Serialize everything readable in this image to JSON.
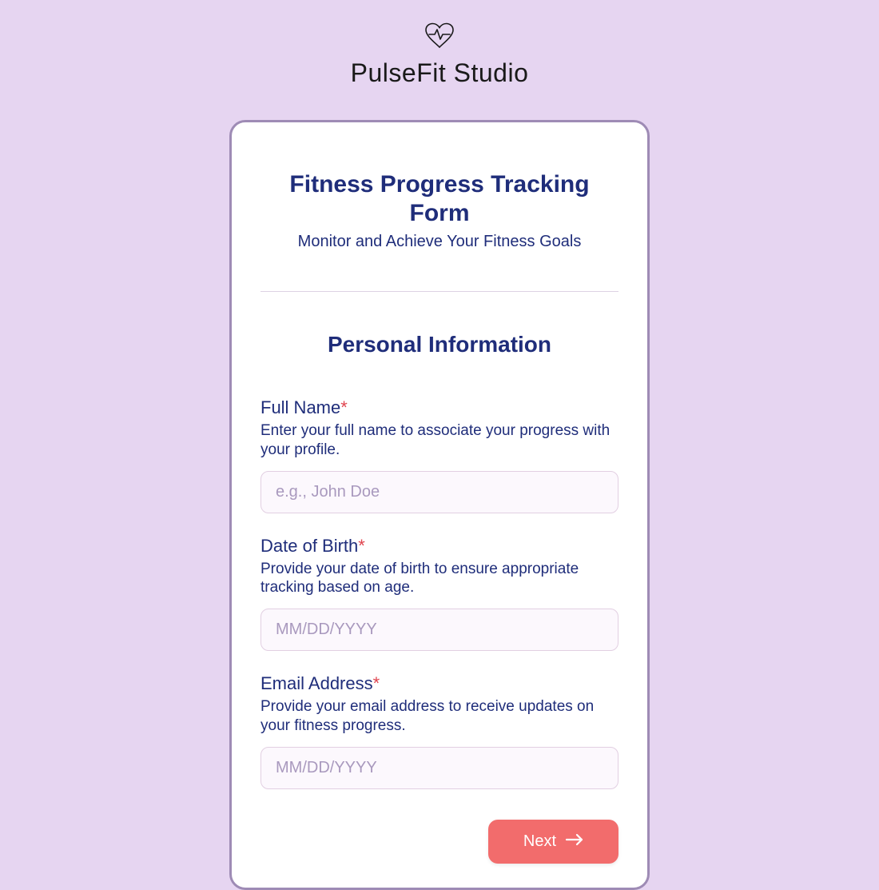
{
  "brand": {
    "name": "PulseFit Studio"
  },
  "form": {
    "title": "Fitness Progress Tracking Form",
    "subtitle": "Monitor and Achieve Your Fitness Goals",
    "section_title": "Personal Information",
    "fields": {
      "full_name": {
        "label": "Full Name",
        "required_mark": "*",
        "help": "Enter your full name to associate your progress with your profile.",
        "placeholder": "e.g., John Doe",
        "value": ""
      },
      "dob": {
        "label": "Date of Birth",
        "required_mark": "*",
        "help": "Provide your date of birth to ensure appropriate tracking based on age.",
        "placeholder": "MM/DD/YYYY",
        "value": ""
      },
      "email": {
        "label": "Email Address",
        "required_mark": "*",
        "help": "Provide your email address to receive updates on your fitness progress.",
        "placeholder": "MM/DD/YYYY",
        "value": ""
      }
    },
    "next_label": "Next"
  },
  "colors": {
    "background": "#e6d5f1",
    "card_border": "#9e8bb5",
    "primary_text": "#1f2d7a",
    "button_bg": "#f26c6c",
    "required": "#e0444e"
  }
}
